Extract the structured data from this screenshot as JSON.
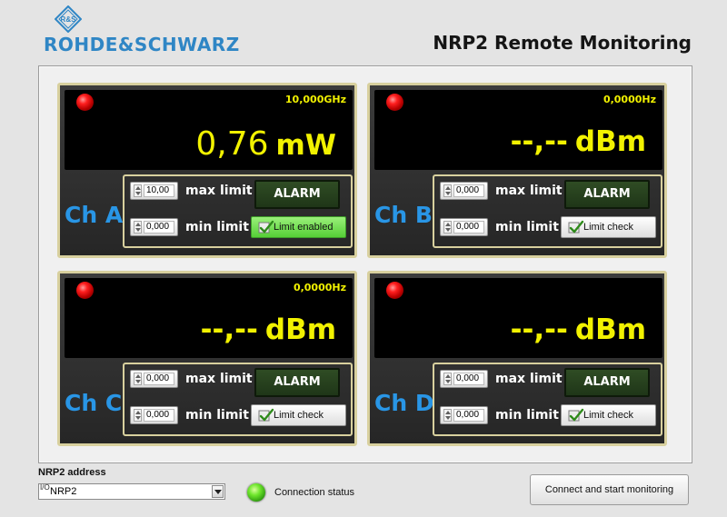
{
  "header": {
    "logo_text": "ROHDE&SCHWARZ",
    "logo_emblem_text": "R&S",
    "title": "NRP2 Remote Monitoring"
  },
  "channels": [
    {
      "label": "Ch A",
      "frequency": "10,000GHz",
      "value": "0,76",
      "unit": "mW",
      "value_placeholder": false,
      "led_color": "#ff1f1f",
      "max_limit": "10,00",
      "min_limit": "0,000",
      "max_limit_label": "max limit",
      "min_limit_label": "min limit",
      "alarm_label": "ALARM",
      "limit_button_label": "Limit enabled",
      "limit_enabled": true
    },
    {
      "label": "Ch B",
      "frequency": "0,0000Hz",
      "value": "--,--",
      "unit": "dBm",
      "value_placeholder": true,
      "led_color": "#ff1f1f",
      "max_limit": "0,000",
      "min_limit": "0,000",
      "max_limit_label": "max limit",
      "min_limit_label": "min limit",
      "alarm_label": "ALARM",
      "limit_button_label": "Limit check",
      "limit_enabled": false
    },
    {
      "label": "Ch C",
      "frequency": "0,0000Hz",
      "value": "--,--",
      "unit": "dBm",
      "value_placeholder": true,
      "led_color": "#ff1f1f",
      "max_limit": "0,000",
      "min_limit": "0,000",
      "max_limit_label": "max limit",
      "min_limit_label": "min limit",
      "alarm_label": "ALARM",
      "limit_button_label": "Limit check",
      "limit_enabled": false
    },
    {
      "label": "Ch D",
      "frequency": "",
      "value": "--,--",
      "unit": "dBm",
      "value_placeholder": true,
      "led_color": "#ff1f1f",
      "max_limit": "0,000",
      "min_limit": "0,000",
      "max_limit_label": "max limit",
      "min_limit_label": "min limit",
      "alarm_label": "ALARM",
      "limit_button_label": "Limit check",
      "limit_enabled": false
    }
  ],
  "footer": {
    "address_label": "NRP2 address",
    "address_io_icon": "I/O",
    "address_value": "NRP2",
    "connection_status_label": "Connection status",
    "connection_led_color": "#6ee62c",
    "connect_button_label": "Connect and start monitoring"
  },
  "colors": {
    "accent_blue": "#2f86c5",
    "display_yellow": "#f2f200",
    "channel_label_blue": "#2996e6",
    "panel_border": "#d8d09e"
  },
  "icons": {
    "logo": "rohde-schwarz-emblem",
    "led": "red-led-indicator",
    "check": "green-checkmark-icon",
    "stepper": "up-down-arrows-icon",
    "dropdown": "chevron-down-icon"
  }
}
